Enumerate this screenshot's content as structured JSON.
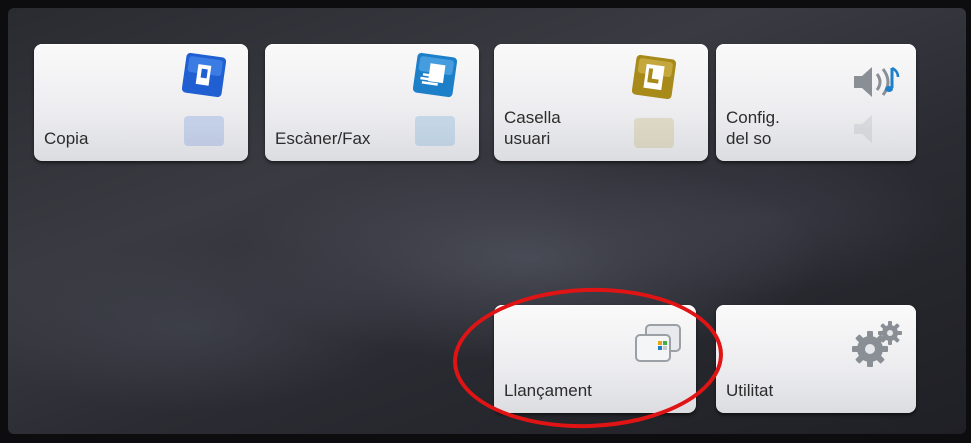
{
  "tiles": [
    {
      "label": "Copia",
      "icon": "copy-icon",
      "color": "#1f5fd1"
    },
    {
      "label": "Escàner/Fax",
      "icon": "scanner-fax-icon",
      "color": "#1e7fc9"
    },
    {
      "label": "Casella\nusuari",
      "icon": "user-box-icon",
      "color": "#a88a1a"
    },
    {
      "label": "Config.\ndel so",
      "icon": "speaker-icon",
      "color": "#8a8f96"
    },
    {
      "label": "Llançament",
      "icon": "launch-icon",
      "color": "#9aa0a6"
    },
    {
      "label": "Utilitat",
      "icon": "gears-icon",
      "color": "#8a8f96"
    }
  ],
  "highlight": {
    "color": "#e01414",
    "target": "Llançament"
  }
}
